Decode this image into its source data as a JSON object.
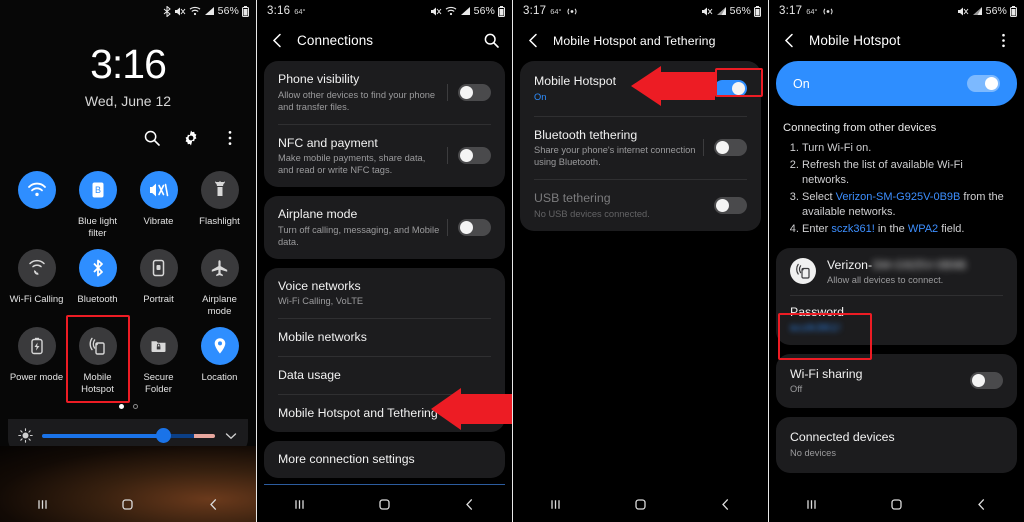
{
  "meta": {
    "accent": "#2e8eff",
    "highlight": "#ed1c24",
    "card_bg": "#1c1c1e"
  },
  "panel1": {
    "status": {
      "time": "",
      "battery": "56%",
      "icons": [
        "bluetooth-icon",
        "mute-icon",
        "wifi-icon",
        "signal-icon",
        "battery-icon"
      ]
    },
    "clock": {
      "time": "3:16",
      "date": "Wed, June 12"
    },
    "header_actions": [
      "search-icon",
      "gear-icon",
      "overflow-menu-icon"
    ],
    "tiles": [
      {
        "label": "",
        "icon": "wifi-icon",
        "on": true,
        "blurred": true
      },
      {
        "label": "Blue light filter",
        "icon": "blue-light-filter-icon",
        "on": true
      },
      {
        "label": "Vibrate",
        "icon": "vibrate-icon",
        "on": true
      },
      {
        "label": "Flashlight",
        "icon": "flashlight-icon",
        "on": false
      },
      {
        "label": "Wi-Fi Calling",
        "icon": "wifi-calling-icon",
        "on": false
      },
      {
        "label": "Bluetooth",
        "icon": "bluetooth-icon",
        "on": true
      },
      {
        "label": "Portrait",
        "icon": "screen-rotation-icon",
        "on": false
      },
      {
        "label": "Airplane mode",
        "icon": "airplane-icon",
        "on": false
      },
      {
        "label": "Power mode",
        "icon": "power-mode-icon",
        "on": false
      },
      {
        "label": "Mobile Hotspot",
        "icon": "hotspot-icon",
        "on": false,
        "highlighted": true
      },
      {
        "label": "Secure Folder",
        "icon": "secure-folder-icon",
        "on": false
      },
      {
        "label": "Location",
        "icon": "location-pin-icon",
        "on": true
      }
    ],
    "brightness": {
      "icon": "brightness-icon",
      "value_pct": 66,
      "expand_icon": "chevron-down-icon"
    },
    "page_dots": 2,
    "active_dot": 0,
    "navbar": [
      "recents-icon",
      "home-icon",
      "back-icon"
    ]
  },
  "panel2": {
    "status": {
      "time": "3:16",
      "temp": "64°",
      "battery": "56%"
    },
    "header": {
      "back": "back-icon",
      "title": "Connections",
      "action": "search-icon"
    },
    "group1": [
      {
        "title": "Phone visibility",
        "sub": "Allow other devices to find your phone and transfer files.",
        "toggle": false
      },
      {
        "title": "NFC and payment",
        "sub": "Make mobile payments, share data, and read or write NFC tags.",
        "toggle": false
      }
    ],
    "group2": [
      {
        "title": "Airplane mode",
        "sub": "Turn off calling, messaging, and Mobile data.",
        "toggle": false
      }
    ],
    "group3": [
      {
        "title": "Voice networks",
        "sub": "Wi-Fi Calling, VoLTE"
      },
      {
        "title": "Mobile networks",
        "sub": ""
      },
      {
        "title": "Data usage",
        "sub": ""
      },
      {
        "title": "Mobile Hotspot and Tethering",
        "sub": "",
        "arrow": true
      }
    ],
    "group4": [
      {
        "title": "More connection settings",
        "sub": ""
      }
    ],
    "navbar": [
      "recents-icon",
      "home-icon",
      "back-icon"
    ]
  },
  "panel3": {
    "status": {
      "time": "3:17",
      "temp": "64°",
      "battery": "56%"
    },
    "header": {
      "back": "back-icon",
      "title": "Mobile Hotspot and Tethering"
    },
    "rows": [
      {
        "title": "Mobile Hotspot",
        "sub": "On",
        "sub_accent": true,
        "toggle": true,
        "highlighted": true,
        "arrow": true
      },
      {
        "title": "Bluetooth tethering",
        "sub": "Share your phone's internet connection using Bluetooth.",
        "toggle": false
      },
      {
        "title": "USB tethering",
        "sub": "No USB devices connected.",
        "toggle": false,
        "disabled": true
      }
    ],
    "navbar": [
      "recents-icon",
      "home-icon",
      "back-icon"
    ]
  },
  "panel4": {
    "status": {
      "time": "3:17",
      "temp": "64°",
      "battery": "56%"
    },
    "header": {
      "back": "back-icon",
      "title": "Mobile Hotspot",
      "action": "overflow-menu-icon"
    },
    "master": {
      "label": "On",
      "toggle": true
    },
    "howto": {
      "heading": "Connecting from other devices",
      "steps": [
        {
          "parts": [
            {
              "t": "Turn Wi-Fi on.",
              "link": false
            }
          ]
        },
        {
          "parts": [
            {
              "t": "Refresh the list of available Wi-Fi networks.",
              "link": false
            }
          ]
        },
        {
          "parts": [
            {
              "t": "Select ",
              "link": false
            },
            {
              "t": "Verizon-SM-G925V-0B9B",
              "link": true
            },
            {
              "t": " from the available networks.",
              "link": false
            }
          ]
        },
        {
          "parts": [
            {
              "t": "Enter ",
              "link": false
            },
            {
              "t": "sczk361!",
              "link": true
            },
            {
              "t": " in the ",
              "link": false
            },
            {
              "t": "WPA2",
              "link": true
            },
            {
              "t": " field.",
              "link": false
            }
          ]
        }
      ]
    },
    "ssid": {
      "icon": "hotspot-icon",
      "name": "Verizon-",
      "name_blurred": "SM-G925V-0B9B",
      "sub": "Allow all devices to connect."
    },
    "password": {
      "label": "Password",
      "value": "sczk361!",
      "highlighted": true
    },
    "wifi_sharing": {
      "title": "Wi-Fi sharing",
      "sub": "Off",
      "toggle": false
    },
    "connected": {
      "title": "Connected devices",
      "sub": "No devices"
    },
    "navbar": [
      "recents-icon",
      "home-icon",
      "back-icon"
    ]
  }
}
